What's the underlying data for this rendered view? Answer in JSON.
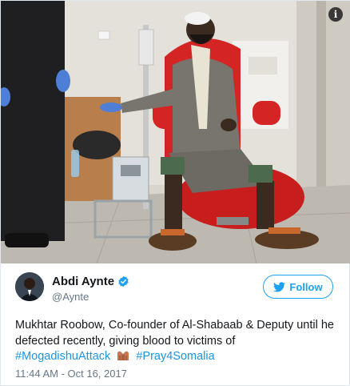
{
  "photo": {
    "alt_badge": "i"
  },
  "author": {
    "display_name": "Abdi Aynte",
    "handle": "@Aynte",
    "verified": true
  },
  "follow_button": {
    "label": "Follow"
  },
  "tweet": {
    "text_lead": "Mukhtar Roobow, Co-founder of Al-Shabaab & Deputy until he defected recently, giving blood to victims of",
    "hashtag_1": "#MogadishuAttack",
    "emoji": "heart-hands-emoji",
    "hashtag_2": "#Pray4Somalia",
    "timestamp": "11:44 AM - Oct 16, 2017"
  },
  "colors": {
    "accent": "#1da1f2",
    "hashtag": "#1b95e0",
    "muted": "#657786",
    "text": "#14171a"
  }
}
